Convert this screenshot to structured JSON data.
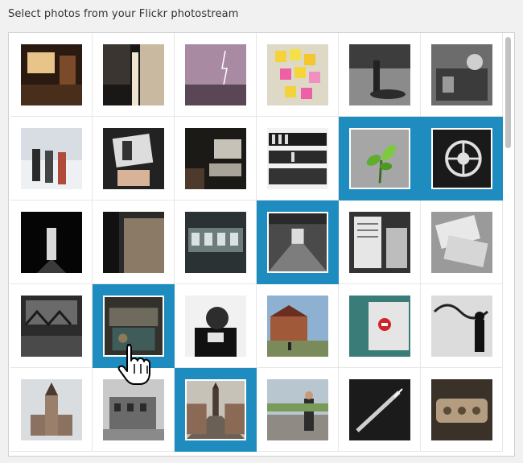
{
  "heading": "Select photos from your Flickr photostream",
  "accent_color": "#1e8cbe",
  "photos": [
    {
      "subject": "warm-room",
      "selected": false
    },
    {
      "subject": "balcony-night",
      "selected": false
    },
    {
      "subject": "lightning-sky",
      "selected": false
    },
    {
      "subject": "sticky-notes",
      "selected": false
    },
    {
      "subject": "factory-floor",
      "selected": false
    },
    {
      "subject": "machinery",
      "selected": false
    },
    {
      "subject": "people-snow",
      "selected": false
    },
    {
      "subject": "hand-photo",
      "selected": false
    },
    {
      "subject": "old-computer",
      "selected": false
    },
    {
      "subject": "archive-shelves",
      "selected": false
    },
    {
      "subject": "green-sprout",
      "selected": true
    },
    {
      "subject": "gear-wheel",
      "selected": true
    },
    {
      "subject": "dark-doorway",
      "selected": false
    },
    {
      "subject": "curtain-dark",
      "selected": false
    },
    {
      "subject": "control-panel",
      "selected": false
    },
    {
      "subject": "abandoned-hall",
      "selected": true
    },
    {
      "subject": "papers-shelf",
      "selected": false
    },
    {
      "subject": "paper-pile",
      "selected": false
    },
    {
      "subject": "ruined-factory",
      "selected": false
    },
    {
      "subject": "rusty-machine",
      "selected": true
    },
    {
      "subject": "man-portrait",
      "selected": false
    },
    {
      "subject": "street-houses",
      "selected": false
    },
    {
      "subject": "red-sign",
      "selected": false
    },
    {
      "subject": "graffiti-man",
      "selected": false
    },
    {
      "subject": "church-tower",
      "selected": false
    },
    {
      "subject": "ruined-house",
      "selected": false
    },
    {
      "subject": "town-street",
      "selected": true
    },
    {
      "subject": "photographer",
      "selected": false
    },
    {
      "subject": "pen-dark",
      "selected": false
    },
    {
      "subject": "metal-detail",
      "selected": false
    }
  ],
  "scrollbar": {
    "position_fraction": 0.0
  },
  "cursor_icon": "hand-pointer-icon"
}
